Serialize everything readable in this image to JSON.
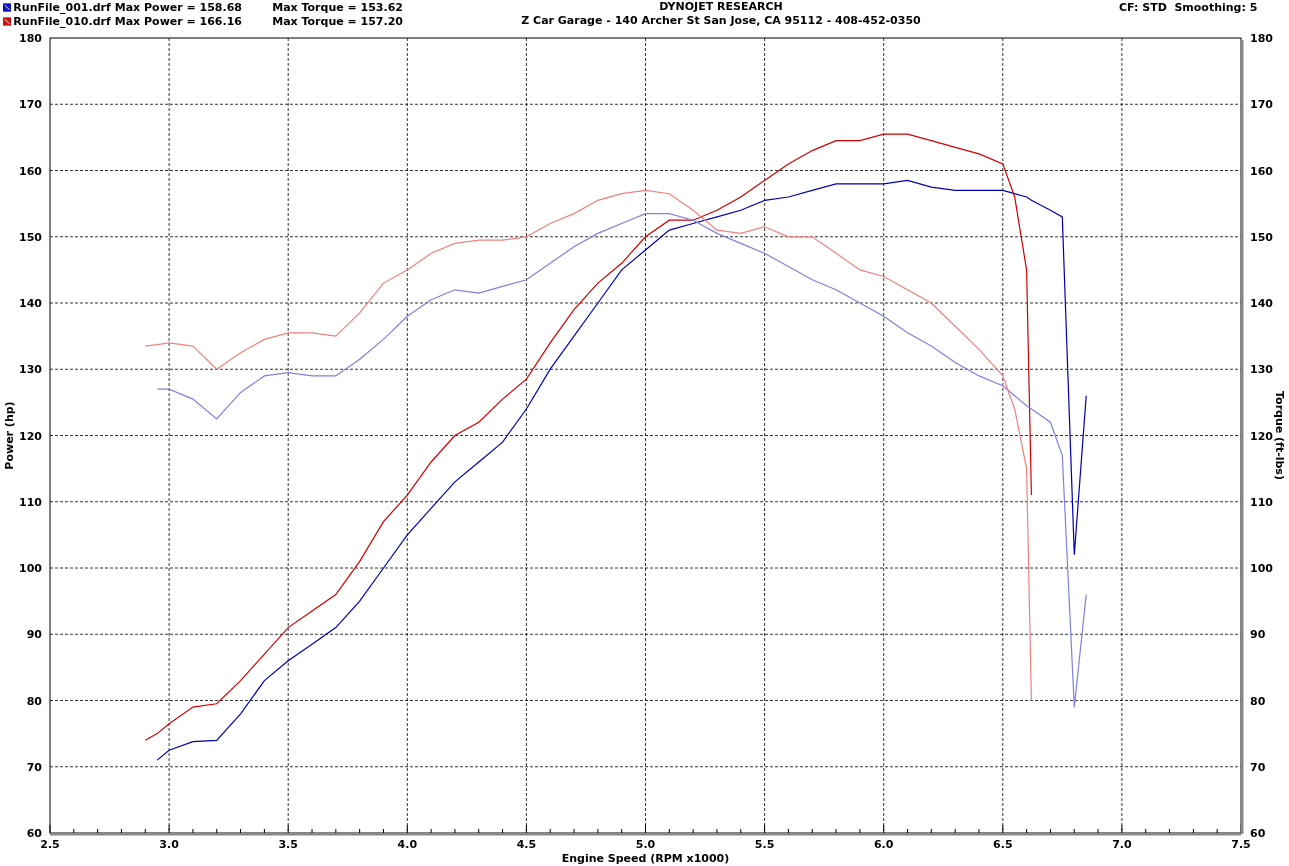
{
  "legend": [
    {
      "file": "RunFile_001.drf",
      "max_power": "Max Power = 158.68",
      "max_torque": "Max Torque = 153.62",
      "color": "#1010c0"
    },
    {
      "file": "RunFile_010.drf",
      "max_power": "Max Power = 166.16",
      "max_torque": "Max Torque = 157.20",
      "color": "#d01010"
    }
  ],
  "title": "DYNOJET RESEARCH",
  "subtitle": "Z Car Garage - 140 Archer St San Jose, CA 95112 - 408-452-0350",
  "settings": "CF: STD  Smoothing: 5",
  "chart": {
    "right_axis": {
      "title": "Torque (ft-lbs)",
      "ticks": [
        "180",
        "170",
        "160",
        "150",
        "140",
        "130",
        "120",
        "110",
        "100",
        "90",
        "80",
        "70",
        "60"
      ]
    },
    "chart_data": {
      "type": "line",
      "grid": true,
      "xlabel": "Engine Speed (RPM x1000)",
      "ylabel": "Power (hp)",
      "xlim": [
        2.5,
        7.5
      ],
      "ylim": [
        60,
        180
      ],
      "xticks": [
        {
          "value": 2.5,
          "label": "2.5"
        },
        {
          "value": 3,
          "label": "3.0"
        },
        {
          "value": 3.5,
          "label": "3.5"
        },
        {
          "value": 4,
          "label": "4.0"
        },
        {
          "value": 4.5,
          "label": "4.5"
        },
        {
          "value": 5,
          "label": "5.0"
        },
        {
          "value": 5.5,
          "label": "5.5"
        },
        {
          "value": 6,
          "label": "6.0"
        },
        {
          "value": 6.5,
          "label": "6.5"
        },
        {
          "value": 7,
          "label": "7.0"
        },
        {
          "value": 7.5,
          "label": "7.5"
        }
      ],
      "yticks": [
        60,
        70,
        80,
        90,
        100,
        110,
        120,
        130,
        140,
        150,
        160,
        170,
        180
      ],
      "x": [
        2.9,
        2.95,
        3.0,
        3.1,
        3.2,
        3.3,
        3.4,
        3.5,
        3.6,
        3.7,
        3.8,
        3.9,
        4.0,
        4.1,
        4.2,
        4.3,
        4.4,
        4.5,
        4.6,
        4.7,
        4.8,
        4.9,
        5.0,
        5.1,
        5.2,
        5.3,
        5.4,
        5.5,
        5.6,
        5.7,
        5.8,
        5.9,
        6.0,
        6.1,
        6.2,
        6.3,
        6.4,
        6.5,
        6.55,
        6.6,
        6.62,
        6.7,
        6.75,
        6.8,
        6.85
      ],
      "series": [
        {
          "color": "#0000b0",
          "values": [
            null,
            71,
            72.5,
            73.8,
            74,
            78,
            83,
            86,
            88.5,
            91,
            95,
            100,
            105,
            109,
            113,
            116,
            119,
            124,
            130,
            135,
            140,
            145,
            148,
            151,
            152,
            153,
            154,
            155.5,
            156,
            157,
            158,
            158,
            158,
            158.5,
            157.5,
            157,
            157,
            157,
            156.5,
            156,
            155.5,
            154,
            153,
            102,
            126
          ]
        },
        {
          "color": "#d00000",
          "values": [
            74,
            75,
            76.5,
            79,
            79.5,
            83,
            87,
            91,
            93.5,
            96,
            101,
            107,
            111,
            116,
            120,
            122,
            125.5,
            128.5,
            134,
            139,
            143,
            146,
            150,
            152.5,
            152.5,
            154,
            156,
            158.5,
            161,
            163,
            164.5,
            164.5,
            165.5,
            165.5,
            164.5,
            163.5,
            162.5,
            161,
            156,
            145,
            111,
            null,
            null,
            null,
            null
          ]
        },
        {
          "color": "#8080e0",
          "values": [
            null,
            127,
            127,
            125.5,
            122.5,
            126.5,
            129,
            129.5,
            129,
            129,
            131.5,
            134.5,
            138,
            140.5,
            142,
            141.5,
            142.5,
            143.5,
            146,
            148.5,
            150.5,
            152,
            153.5,
            153.5,
            152.5,
            150.5,
            149,
            147.5,
            145.5,
            143.5,
            142,
            140,
            138,
            135.5,
            133.5,
            131,
            129,
            127.5,
            126,
            124.5,
            124,
            122,
            117,
            79,
            96
          ]
        },
        {
          "color": "#f08080",
          "values": [
            133.5,
            133.7,
            134,
            133.5,
            130,
            132.5,
            134.5,
            135.5,
            135.5,
            135,
            138.5,
            143,
            145,
            147.5,
            149,
            149.5,
            149.5,
            150,
            152,
            153.5,
            155.5,
            156.5,
            157,
            156.5,
            154,
            151,
            150.5,
            151.5,
            150,
            150,
            147.5,
            145,
            144,
            142,
            140,
            136.5,
            133,
            129,
            124,
            115,
            80,
            null,
            null,
            null,
            null
          ]
        }
      ]
    }
  }
}
